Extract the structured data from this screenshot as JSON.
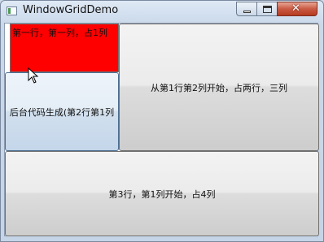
{
  "window": {
    "title": "WindowGridDemo",
    "controls": {
      "minimize": "minimize",
      "maximize": "maximize",
      "close": "close"
    }
  },
  "grid": {
    "cell_r0_c0": "第一行，第一列，占1列",
    "cell_r1_c0": "后台代码生成(第2行第1列",
    "cell_r1_c1_span": "从第1行第2列开始，占两行，三列",
    "cell_r2_c0_span": "第3行，第1列开始，占4列"
  },
  "colors": {
    "red_cell": "#ff0000",
    "accent": "#c95a43"
  }
}
